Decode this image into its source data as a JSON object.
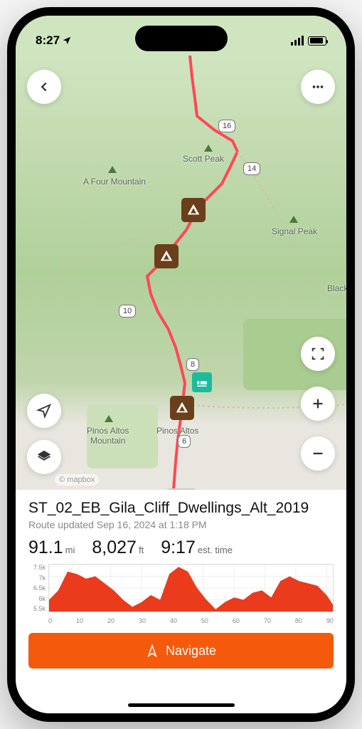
{
  "status_bar": {
    "time": "8:27",
    "location_icon": "location-arrow"
  },
  "map": {
    "labels": {
      "scott_peak": "Scott Peak",
      "a_four_mountain": "A Four Mountain",
      "signal_peak": "Signal Peak",
      "black": "Black",
      "pinos_altos": "Pinos Altos",
      "pinos_altos_mountain": "Pinos Altos\nMountain"
    },
    "mile_markers": [
      "16",
      "14",
      "10",
      "8",
      "6"
    ],
    "poi": [
      {
        "type": "camp"
      },
      {
        "type": "camp"
      },
      {
        "type": "lodge"
      },
      {
        "type": "camp"
      }
    ],
    "attribution": "© mapbox"
  },
  "route": {
    "title": "ST_02_EB_Gila_Cliff_Dwellings_Alt_2019",
    "updated": "Route updated Sep 16, 2024 at 1:18 PM",
    "stats": {
      "distance_value": "91.1",
      "distance_unit": "mi",
      "elevation_value": "8,027",
      "elevation_unit": "ft",
      "time_value": "9:17",
      "time_unit": "est. time"
    }
  },
  "chart_data": {
    "type": "area",
    "title": "",
    "xlabel": "",
    "ylabel": "",
    "xlim": [
      0,
      92
    ],
    "ylim": [
      5500,
      7500
    ],
    "y_ticks": [
      "7.5k",
      "7k",
      "6.5k",
      "6k",
      "5.5k"
    ],
    "x_ticks": [
      "0",
      "10",
      "20",
      "30",
      "40",
      "50",
      "60",
      "70",
      "80",
      "90"
    ],
    "x": [
      0,
      3,
      6,
      9,
      12,
      15,
      18,
      21,
      24,
      27,
      30,
      33,
      36,
      39,
      42,
      45,
      48,
      51,
      54,
      57,
      60,
      63,
      66,
      69,
      72,
      75,
      78,
      81,
      84,
      87,
      90,
      92
    ],
    "values": [
      6000,
      6400,
      7200,
      7100,
      6900,
      7000,
      6700,
      6400,
      6000,
      5700,
      5900,
      6200,
      6000,
      7100,
      7400,
      7200,
      6500,
      6000,
      5600,
      5900,
      6100,
      6000,
      6300,
      6400,
      6100,
      6800,
      7000,
      6800,
      6700,
      6600,
      6200,
      5800
    ],
    "fill_color": "#ea3b1d"
  },
  "actions": {
    "navigate_label": "Navigate"
  }
}
